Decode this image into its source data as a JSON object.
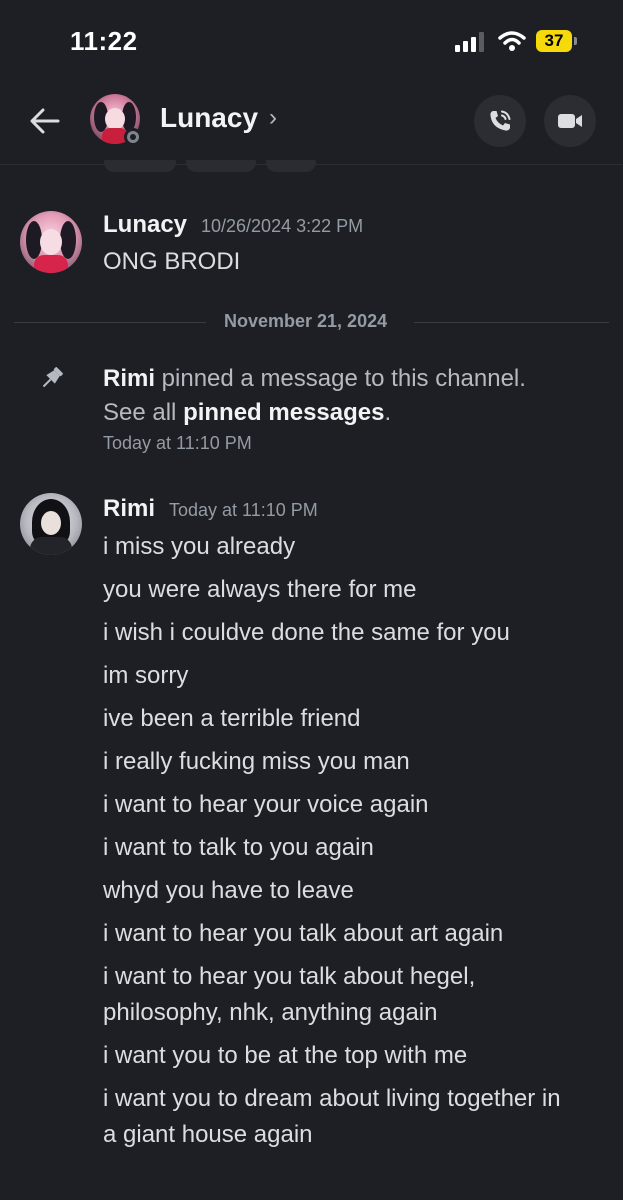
{
  "status_bar": {
    "time": "11:22",
    "battery": "37"
  },
  "header": {
    "name": "Lunacy",
    "chevron": "›"
  },
  "icons": {
    "back": "arrow-left-icon",
    "call": "phone-icon",
    "video": "video-camera-icon",
    "pin": "pin-icon"
  },
  "colors": {
    "background": "#1e1f24",
    "battery": "#f5d90a",
    "status_idle": "#80848e"
  },
  "messages": {
    "lunacy": {
      "author": "Lunacy",
      "timestamp": "10/26/2024 3:22 PM",
      "lines": [
        "ONG BRODI"
      ]
    },
    "divider": "November 21, 2024",
    "pinned": {
      "actor": "Rimi",
      "action": " pinned a message to this channel.",
      "prefix": "See all ",
      "link": "pinned messages",
      "suffix": ".",
      "timestamp": "Today at 11:10 PM"
    },
    "rimi": {
      "author": "Rimi",
      "timestamp": "Today at 11:10 PM",
      "lines": [
        "i miss you already",
        "you were always there for me",
        "i wish i couldve done the same for you",
        "im sorry",
        "ive been a terrible friend",
        "i really fucking miss you man",
        "i want to hear your voice again",
        "i want to talk to you again",
        "whyd you have to leave",
        "i want to hear you talk about art again",
        "i want to hear you talk about hegel,",
        "philosophy, nhk, anything again",
        "i want you to be at the top with me",
        "i want you to dream about living together in",
        "a giant house again"
      ]
    }
  }
}
